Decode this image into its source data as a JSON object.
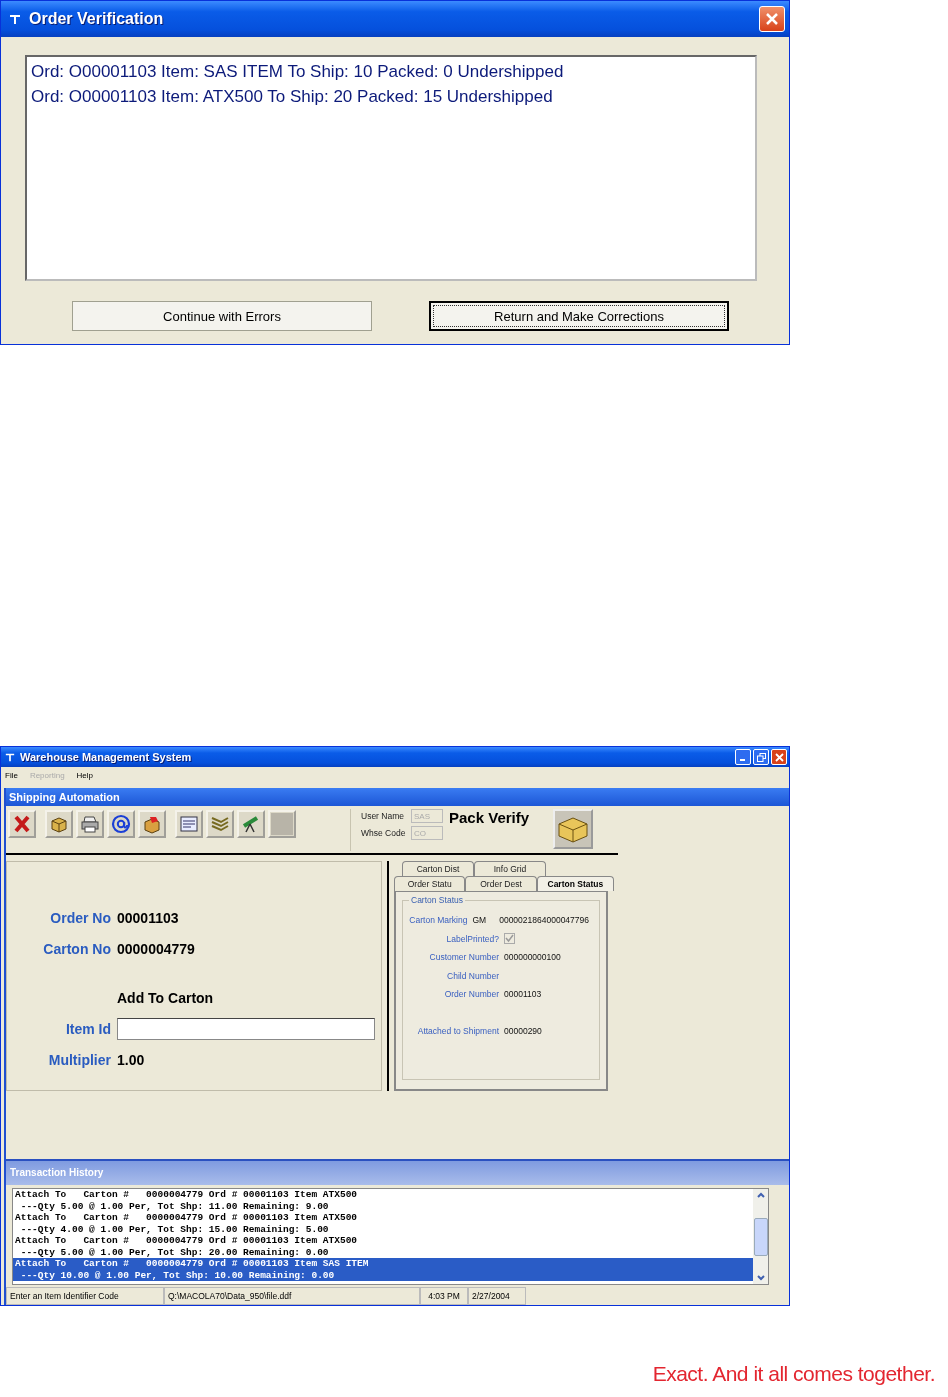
{
  "dialog": {
    "title": "Order Verification",
    "messages": [
      "Ord: O00001103 Item: SAS ITEM To Ship: 10 Packed: 0 Undershipped",
      "Ord: O00001103 Item: ATX500 To Ship: 20 Packed: 15 Undershipped"
    ],
    "buttons": [
      {
        "label": "Continue with Errors",
        "focused": false
      },
      {
        "label": "Return and Make Corrections",
        "focused": true
      }
    ]
  },
  "main_window": {
    "title": "Warehouse Management System",
    "menu": [
      {
        "label": "File",
        "disabled": false
      },
      {
        "label": "Reporting",
        "disabled": true
      },
      {
        "label": "Help",
        "disabled": false
      }
    ],
    "panel_title": "Shipping Automation",
    "toolbar": [
      {
        "kind": "delete"
      },
      {
        "kind": "box"
      },
      {
        "kind": "printer"
      },
      {
        "kind": "email"
      },
      {
        "kind": "box-tag"
      },
      {
        "kind": "form"
      },
      {
        "kind": "stack"
      },
      {
        "kind": "scanner"
      },
      {
        "kind": "blank"
      }
    ],
    "user_fields": [
      {
        "label": "User Name",
        "value": "SAS",
        "disabled": true
      },
      {
        "label": "Whse Code",
        "value": "CO",
        "disabled": true
      }
    ],
    "mode_title": "Pack Verify",
    "order_form": [
      {
        "kind": "text",
        "label": "Order No",
        "value": "00001103"
      },
      {
        "kind": "text",
        "label": "Carton No",
        "value": "0000004779"
      },
      {
        "kind": "heading",
        "value": "Add To Carton"
      },
      {
        "kind": "input",
        "label": "Item Id"
      },
      {
        "kind": "text",
        "label": "Multiplier",
        "value": "1.00"
      }
    ],
    "tabs": [
      [
        {
          "label": "Carton Dist",
          "selected": false
        },
        {
          "label": "Info Grid",
          "selected": false
        }
      ],
      [
        {
          "label": "Order Statu",
          "selected": false
        },
        {
          "label": "Order Dest",
          "selected": false
        },
        {
          "label": "Carton Status",
          "selected": true
        }
      ]
    ],
    "carton_status": {
      "title": "Carton Status",
      "fields": [
        {
          "kind": "text",
          "label": "Carton Marking",
          "values": [
            "GM",
            "0000021864000047796"
          ]
        },
        {
          "kind": "checkbox",
          "label": "LabelPrinted?",
          "checked": true,
          "disabled": true
        },
        {
          "kind": "text",
          "label": "Customer Number",
          "values": [
            "000000000100"
          ]
        },
        {
          "kind": "text",
          "label": "Child Number"
        },
        {
          "kind": "text",
          "label": "Order Number",
          "values": [
            "00001103"
          ]
        },
        {
          "kind": "text",
          "label": "Attached to Shipment",
          "values": [
            "00000290"
          ]
        }
      ]
    },
    "transaction_history": {
      "title": "Transaction History",
      "entries": [
        {
          "lines": [
            "Attach To   Carton #   0000004779 Ord # 00001103 Item ATX500",
            " ---Qty 5.00 @ 1.00 Per, Tot Shp: 11.00 Remaining: 9.00"
          ],
          "selected": false
        },
        {
          "lines": [
            "Attach To   Carton #   0000004779 Ord # 00001103 Item ATX500",
            " ---Qty 4.00 @ 1.00 Per, Tot Shp: 15.00 Remaining: 5.00"
          ],
          "selected": false
        },
        {
          "lines": [
            "Attach To   Carton #   0000004779 Ord # 00001103 Item ATX500",
            " ---Qty 5.00 @ 1.00 Per, Tot Shp: 20.00 Remaining: 0.00"
          ],
          "selected": false
        },
        {
          "lines": [
            "Attach To   Carton #   0000004779 Ord # 00001103 Item SAS ITEM",
            " ---Qty 10.00 @ 1.00 Per, Tot Shp: 10.00 Remaining: 0.00"
          ],
          "selected": true
        }
      ]
    },
    "status_bar": [
      "Enter an Item Identifier Code",
      "Q:\\MACOLA70\\Data_950\\file.ddf",
      "4:03 PM",
      "2/27/2004"
    ]
  },
  "tagline": "Exact. And it all comes together."
}
